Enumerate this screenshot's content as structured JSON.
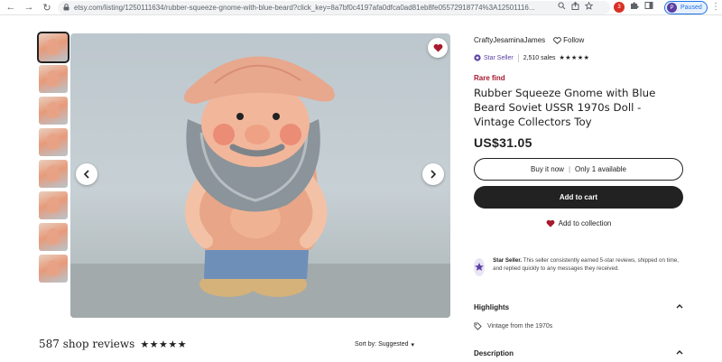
{
  "browser": {
    "back": "←",
    "forward": "→",
    "reload": "↻",
    "url": "etsy.com/listing/1250111634/rubber-squeeze-gnome-with-blue-beard?click_key=8a7bf0c4197afa0dfca0ad81eb8fe05572918774%3A12501116...",
    "profile_initial": "P",
    "profile_status": "Paused",
    "ext_badge": "3"
  },
  "gallery": {
    "thumbnail_count": 8
  },
  "shop": {
    "name": "CraftyJesaminaJames",
    "follow_label": "Follow",
    "star_seller_label": "Star Seller",
    "sales": "2,510 sales",
    "stars": "★★★★★"
  },
  "listing": {
    "rare_label": "Rare find",
    "title": "Rubber Squeeze Gnome with Blue Beard Soviet USSR 1970s Doll - Vintage Collectors Toy",
    "price": "US$31.05",
    "buy_now_label": "Buy it now",
    "availability": "Only 1 available",
    "add_to_cart_label": "Add to cart",
    "add_to_collection_label": "Add to collection"
  },
  "star_seller_info": {
    "bold": "Star Seller.",
    "text": " This seller consistently earned 5-star reviews, shipped on time, and replied quickly to any messages they received."
  },
  "highlights": {
    "heading": "Highlights",
    "item": "Vintage from the 1970s"
  },
  "description": {
    "heading": "Description"
  },
  "reviews": {
    "label": "587 shop reviews",
    "stars": "★★★★★",
    "sort_label": "Sort by: Suggested"
  },
  "colors": {
    "accent_dark": "#222222",
    "rare_red": "#a61a2e",
    "star_seller_purple": "#5b3ea4",
    "heart_red": "#a61a2e"
  }
}
